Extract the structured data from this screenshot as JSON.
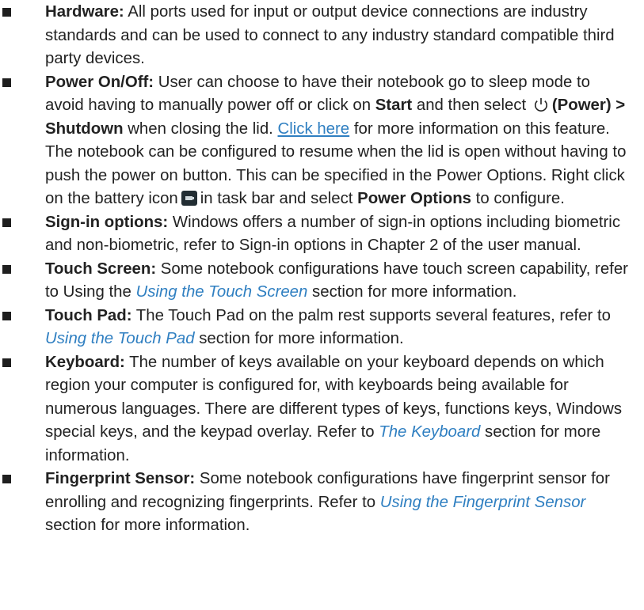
{
  "items": [
    {
      "title": "Hardware:",
      "text": " All ports used for input or output device connections are industry standards and can be used to connect to any industry standard compatible third party devices."
    },
    {
      "title": "Power On/Off:",
      "t1": " User can choose to have their notebook go to sleep mode to avoid having to manually power off or click on ",
      "b1": "Start",
      "t2": " and then select ",
      "icon": "power-icon",
      "b2": "(Power) > Shutdown",
      "t3": " when closing the lid. ",
      "link": "Click here",
      "t4": " for more information on this feature. The notebook can be configured to resume when the lid is open without having to push the power on button. This can be specified in the Power Options. Right click on the battery icon",
      "icon2": "battery-icon",
      "t5": "in task bar and select ",
      "b3": "Power Options",
      "t6": " to configure."
    },
    {
      "title": "Sign-in options:",
      "text": " Windows offers a number of sign-in options including biometric and non-biometric, refer to Sign-in options in Chapter 2 of the user manual."
    },
    {
      "title": "Touch Screen:",
      "t1": " Some notebook configurations have touch screen capability, refer to Using the ",
      "xref": "Using the Touch Screen",
      "t2": " section for more information."
    },
    {
      "title": "Touch Pad:",
      "t1": " The Touch Pad on the palm rest supports several features, refer to ",
      "xref": "Using the Touch Pad",
      "t2": " section for more information."
    },
    {
      "title": "Keyboard:",
      "t1": " The number of keys available on your keyboard depends on which region your computer is configured for, with keyboards being available for numerous languages. There are different types of keys, functions keys, Windows special keys, and the keypad overlay. Refer to ",
      "xref": "The Keyboard",
      "t2": " section for more information."
    },
    {
      "title": "Fingerprint Sensor:",
      "t1": " Some notebook configurations have fingerprint sensor for enrolling and recognizing fingerprints. Refer to ",
      "xref": "Using the Fingerprint Sensor",
      "t2": " section for more information."
    }
  ],
  "colors": {
    "text": "#222222",
    "link": "#2f7fc1",
    "bullet": "#1f1f1f"
  }
}
